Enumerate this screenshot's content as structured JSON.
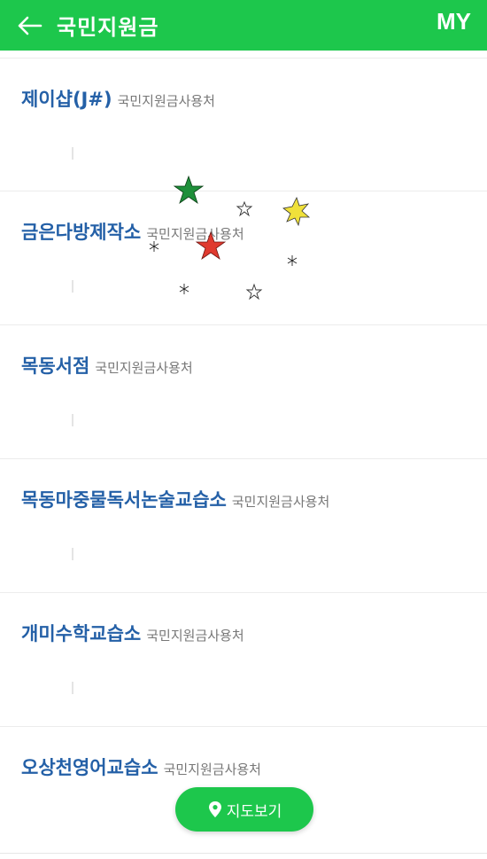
{
  "header": {
    "title": "국민지원금",
    "my_label": "MY",
    "accent_color": "#1dc74c"
  },
  "list": {
    "items": [
      {
        "name": "제이샵(J#)",
        "tag": "국민지원금사용처"
      },
      {
        "name": "금은다방제작소",
        "tag": "국민지원금사용처"
      },
      {
        "name": "목동서점",
        "tag": "국민지원금사용처"
      },
      {
        "name": "목동마중물독서논술교습소",
        "tag": "국민지원금사용처"
      },
      {
        "name": "개미수학교습소",
        "tag": "국민지원금사용처"
      },
      {
        "name": "오상천영어교습소",
        "tag": "국민지원금사용처"
      }
    ]
  },
  "map_button": {
    "label": "지도보기",
    "icon": "location-pin-icon"
  }
}
